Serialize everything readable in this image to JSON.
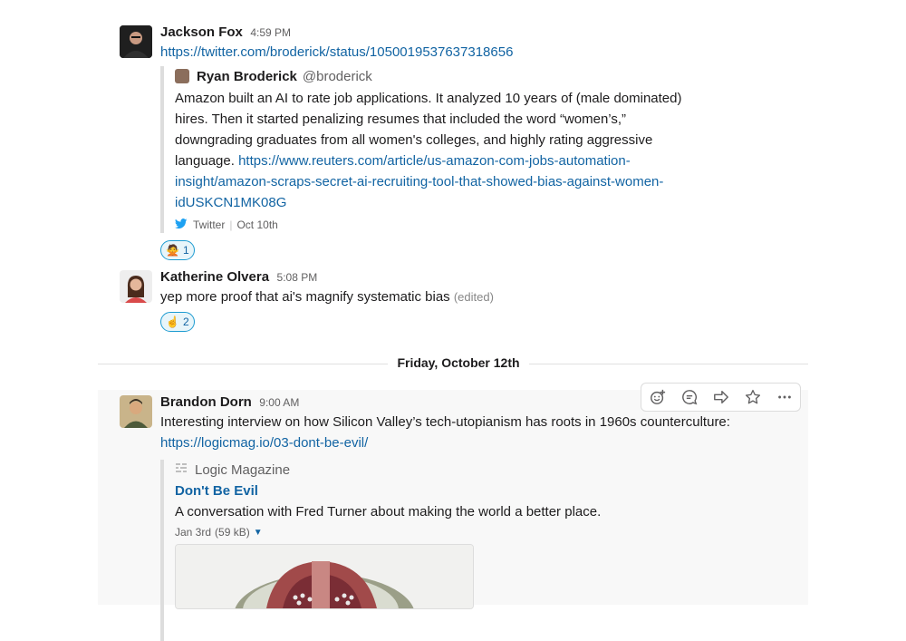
{
  "messages": [
    {
      "author": "Jackson Fox",
      "time": "4:59 PM",
      "link": "https://twitter.com/broderick/status/1050019537637318656",
      "quote": {
        "author": "Ryan Broderick",
        "handle": "@broderick",
        "text": "Amazon built an AI to rate job applications. It analyzed 10 years of (male dominated) hires. Then it started penalizing resumes that included the word “women’s,” downgrading graduates from all women's colleges, and highly rating aggressive language.",
        "link": "https://www.reuters.com/article/us-amazon-com-jobs-automation-insight/amazon-scraps-secret-ai-recruiting-tool-that-showed-bias-against-women-idUSKCN1MK08G",
        "source": "Twitter",
        "date": "Oct 10th"
      },
      "reaction": {
        "emoji": "🙅",
        "count": "1"
      }
    },
    {
      "author": "Katherine Olvera",
      "time": "5:08 PM",
      "text": "yep more proof that ai's magnify systematic bias",
      "edited": "(edited)",
      "reaction": {
        "emoji": "☝",
        "count": "2"
      }
    },
    {
      "author": "Brandon Dorn",
      "time": "9:00 AM",
      "text": "Interesting interview on how Silicon Valley’s tech-utopianism has roots in 1960s counterculture:",
      "link": "https://logicmag.io/03-dont-be-evil/",
      "preview": {
        "site": "Logic Magazine",
        "title": "Don't Be Evil",
        "desc": "A conversation with Fred Turner about making the world a better place.",
        "date": "Jan 3rd",
        "size": "(59 kB)"
      }
    }
  ],
  "divider": {
    "label": "Friday, October 12th"
  },
  "toolbar_icons": [
    "add-reaction-icon",
    "start-thread-icon",
    "share-icon",
    "star-icon",
    "more-actions-icon"
  ]
}
